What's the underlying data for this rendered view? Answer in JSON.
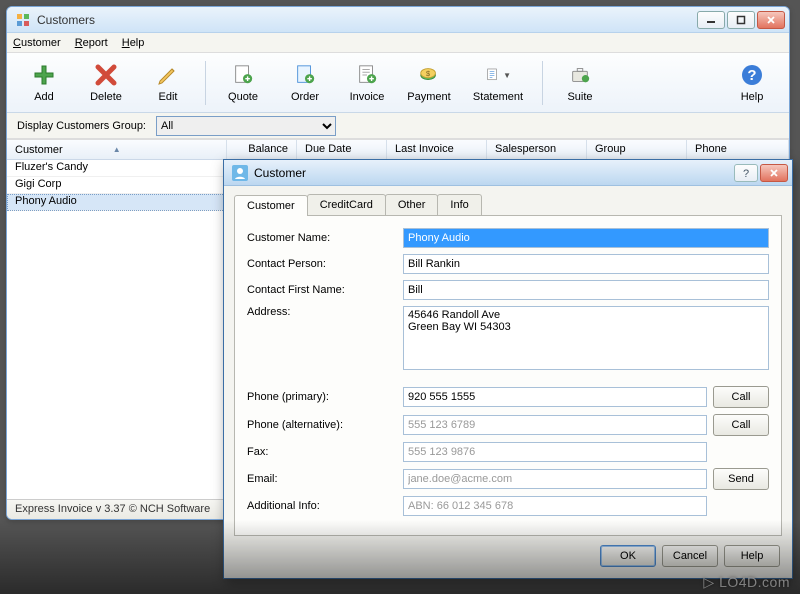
{
  "main": {
    "title": "Customers",
    "menu": {
      "customer": "Customer",
      "report": "Report",
      "help": "Help"
    },
    "toolbar": {
      "add": "Add",
      "delete": "Delete",
      "edit": "Edit",
      "quote": "Quote",
      "order": "Order",
      "invoice": "Invoice",
      "payment": "Payment",
      "statement": "Statement",
      "suite": "Suite",
      "help": "Help"
    },
    "filter": {
      "label": "Display Customers Group:",
      "value": "All"
    },
    "columns": {
      "customer": "Customer",
      "balance": "Balance",
      "due": "Due Date",
      "last": "Last Invoice",
      "sales": "Salesperson",
      "group": "Group",
      "phone": "Phone"
    },
    "rows": [
      "Fluzer's Candy",
      "Gigi Corp",
      "Phony Audio"
    ],
    "selected_index": 2,
    "status": "Express Invoice v 3.37 © NCH Software"
  },
  "dialog": {
    "title": "Customer",
    "tabs": [
      "Customer",
      "CreditCard",
      "Other",
      "Info"
    ],
    "active_tab": 0,
    "fields": {
      "name_label": "Customer Name:",
      "name_value": "Phony Audio",
      "contact_label": "Contact Person:",
      "contact_value": "Bill Rankin",
      "firstname_label": "Contact First Name:",
      "firstname_value": "Bill",
      "address_label": "Address:",
      "address_value": "45646 Randoll Ave\nGreen Bay WI 54303",
      "phone1_label": "Phone (primary):",
      "phone1_value": "920 555 1555",
      "phone2_label": "Phone (alternative):",
      "phone2_placeholder": "555 123 6789",
      "fax_label": "Fax:",
      "fax_placeholder": "555 123 9876",
      "email_label": "Email:",
      "email_placeholder": "jane.doe@acme.com",
      "addl_label": "Additional Info:",
      "addl_placeholder": "ABN: 66 012 345 678"
    },
    "buttons": {
      "call": "Call",
      "send": "Send",
      "ok": "OK",
      "cancel": "Cancel",
      "help": "Help"
    }
  },
  "watermark": "▷ LO4D.com"
}
